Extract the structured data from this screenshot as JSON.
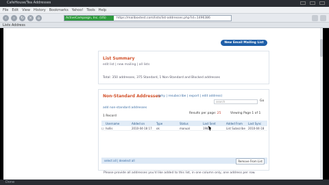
{
  "browser": {
    "window_title": "CafeHouse/Tea Addresses",
    "menu": [
      "File",
      "Edit",
      "View",
      "History",
      "Bookmarks",
      "Yahoo!",
      "Tools",
      "Help"
    ],
    "secure_site": "ActiveCampaign, Inc. (US)",
    "url": "https://mailboxtest.com/lists/list-addresses.php?id=1496386",
    "tab_label": "Lists Address",
    "status": "Done"
  },
  "page": {
    "new_button": "New Email Mailing List",
    "list_summary": {
      "title": "List Summary",
      "links": "edit list | new mailing | all lists",
      "summary_line": "Total: 350 addresses, 375 Standard, 1 Non-Standard and Blocked addresses"
    },
    "non_standard": {
      "title": "Non-Standard Addresses",
      "header_links": "(why | resubscribe | export | edit address)",
      "search_placeholder": "search",
      "go_label": "Go",
      "add_link": "add non-standard addresses",
      "record_count": "1 Record",
      "results_per_page_label": "Results per page:",
      "results_per_page_value": "25",
      "viewing_page": "Viewing Page 1 of 1",
      "columns": [
        "",
        "Username",
        "Added on",
        "Type",
        "Status",
        "Last Sent",
        "Added From",
        "Last Sync"
      ],
      "rows": [
        [
          "",
          "hollis",
          "2010-04-18 17",
          "ok",
          "manual",
          "1982",
          "List Subscribe",
          "2010-04-18"
        ]
      ],
      "bulk_left": "select all | deselect all",
      "bulk_right": "Remove From List"
    },
    "footnote": "Please provide all addresses you'd like added to this list, in one column only, one address per row."
  }
}
